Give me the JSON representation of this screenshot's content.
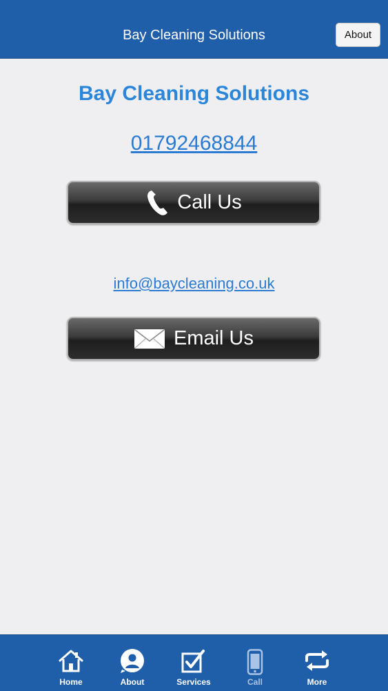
{
  "header": {
    "title": "Bay Cleaning Solutions",
    "about_button": "About"
  },
  "main": {
    "heading": "Bay Cleaning Solutions",
    "phone": "01792468844",
    "call_button": "Call Us",
    "email": "info@baycleaning.co.uk",
    "email_button": "Email Us"
  },
  "tabs": [
    {
      "label": "Home",
      "icon": "home-icon"
    },
    {
      "label": "About",
      "icon": "person-icon"
    },
    {
      "label": "Services",
      "icon": "checkbox-icon"
    },
    {
      "label": "Call",
      "icon": "phone-icon"
    },
    {
      "label": "More",
      "icon": "repeat-icon"
    }
  ],
  "colors": {
    "bar": "#1f5ea9",
    "heading": "#2b86d9",
    "link": "#2a7bd1",
    "background": "#efeff1"
  }
}
